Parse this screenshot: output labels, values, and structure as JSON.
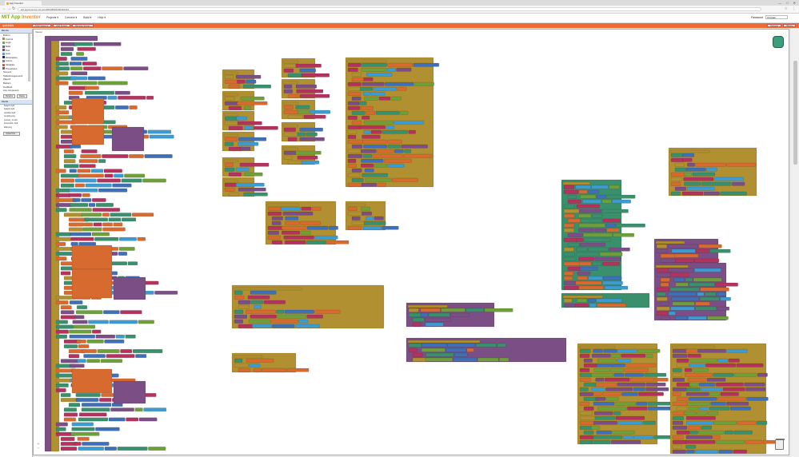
{
  "browser": {
    "tab_title": "App Inventor",
    "url": "ai2.appinventor.mit.edu/#5638826290364416",
    "window_controls": [
      "—",
      "□",
      "✕"
    ]
  },
  "app": {
    "logo_main": "MIT App",
    "logo_accent": " Inventor",
    "menus": [
      "Projects ▾",
      "Connect ▾",
      "Build ▾",
      "Help ▾"
    ],
    "user_label": "Password",
    "user_select": "OCQaer"
  },
  "toolbar": {
    "project_name": "quiz4kids",
    "screen_buttons": [
      "SCR Sreens ▾",
      "Add Screen",
      "Remove Screen"
    ],
    "mode_buttons": [
      "Designer",
      "Blocks"
    ]
  },
  "left": {
    "blocks_header": "Blocks",
    "tree": [
      {
        "label": "Built-in",
        "color": ""
      },
      {
        "label": "Control",
        "color": "#b18e35"
      },
      {
        "label": "Logic",
        "color": "#77ab41"
      },
      {
        "label": "Math",
        "color": "#3f71b5"
      },
      {
        "label": "Text",
        "color": "#b32d5e"
      },
      {
        "label": "Lists",
        "color": "#49a6d4"
      },
      {
        "label": "Dictionaries",
        "color": "#2d1799"
      },
      {
        "label": "Colors",
        "color": "#7d7d7d"
      },
      {
        "label": "Variables",
        "color": "#d05f2d"
      },
      {
        "label": "Procedures",
        "color": "#7c5385"
      },
      {
        "label": "Screen1",
        "color": ""
      },
      {
        "label": "TableArrangement1",
        "color": ""
      },
      {
        "label": "Player1",
        "color": ""
      },
      {
        "label": "Button1",
        "color": ""
      },
      {
        "label": "TextBox1",
        "color": ""
      },
      {
        "label": "Any component",
        "color": ""
      }
    ],
    "tree_buttons": [
      "Rename",
      "Delete"
    ],
    "media_header": "Media",
    "media": [
      "beep1.mp3",
      "beep2.mp3",
      "cocoba.mp3",
      "cur.kitty.png",
      "correct_1.mp3",
      "incorrect1.mp3",
      "kids.png"
    ],
    "upload_label": "Upload File ..."
  },
  "workspace": {
    "viewer_label": "Viewer"
  }
}
